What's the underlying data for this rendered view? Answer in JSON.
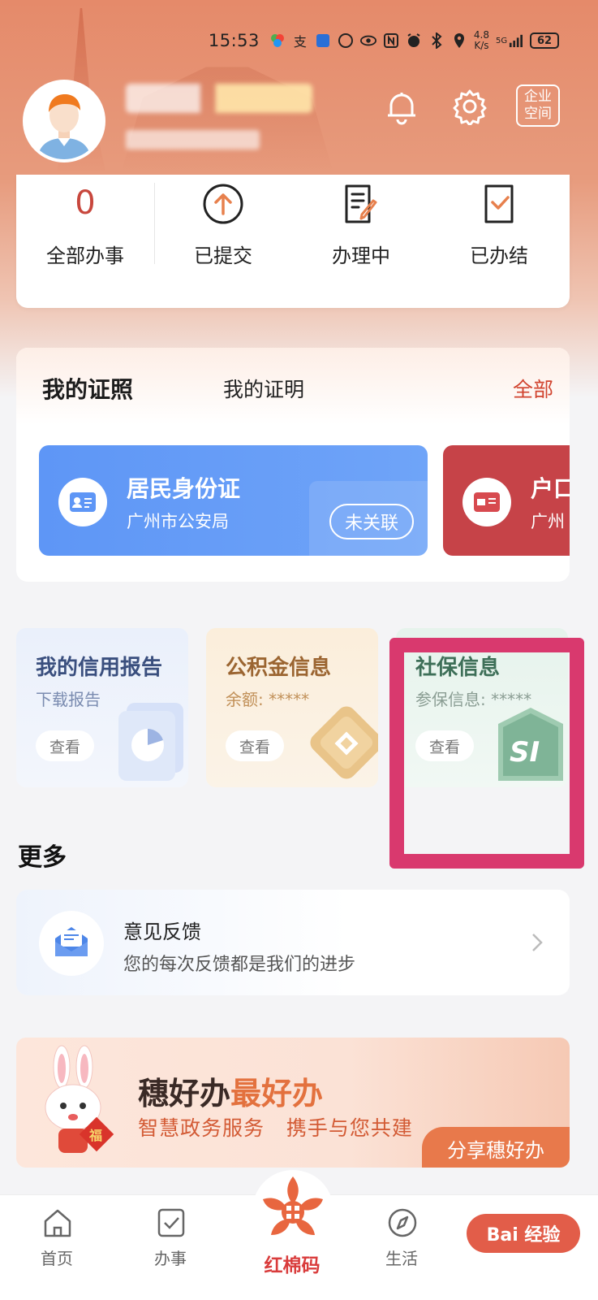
{
  "status_bar": {
    "time": "15:53",
    "net_speed_value": "4.8",
    "net_speed_unit": "K/s",
    "signal_label": "5G",
    "battery": "62"
  },
  "header": {
    "enterprise_label_line1": "企业",
    "enterprise_label_line2": "空间"
  },
  "tasks": [
    {
      "count": "0",
      "label": "全部办事"
    },
    {
      "label": "已提交",
      "icon": "upload-circle-icon"
    },
    {
      "label": "办理中",
      "icon": "document-edit-icon"
    },
    {
      "label": "已办结",
      "icon": "check-document-icon"
    }
  ],
  "certificates": {
    "tab_active": "我的证照",
    "tab_other": "我的证明",
    "all_link": "全部",
    "cards": [
      {
        "title": "居民身份证",
        "issuer": "广州市公安局",
        "badge": "未关联",
        "color": "#5e96f6"
      },
      {
        "title": "户口",
        "issuer": "广州",
        "color": "#c64348"
      }
    ]
  },
  "info_cards": [
    {
      "title": "我的信用报告",
      "subtitle": "下载报告",
      "button": "查看"
    },
    {
      "title": "公积金信息",
      "subtitle": "余额: *****",
      "button": "查看"
    },
    {
      "title": "社保信息",
      "subtitle": "参保信息: *****",
      "button": "查看"
    }
  ],
  "more": {
    "title": "更多",
    "feedback_title": "意见反馈",
    "feedback_subtitle": "您的每次反馈都是我们的进步"
  },
  "banner": {
    "title_part1": "穗好办",
    "title_part2": "最好办",
    "subtitle": "智慧政务服务   携手与您共建",
    "share_button": "分享穗好办",
    "rabbit_sign": "福"
  },
  "tabbar": {
    "home": "首页",
    "affairs": "办事",
    "center": "红棉码",
    "life": "生活",
    "watermark": "Bai 经验"
  },
  "colors": {
    "accent_red": "#d1442f",
    "highlight_box": "#d9396e"
  }
}
